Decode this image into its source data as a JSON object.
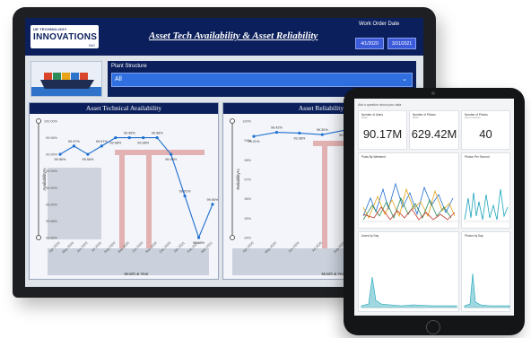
{
  "dashboard": {
    "brand_top": "UE TECHNOLOGY",
    "brand_main": "INNOVATIONS",
    "brand_inc": "INC",
    "title": "Asset Tech Availability & Asset Reliability",
    "work_order_label": "Work Order Date",
    "date_start": "4/1/2020",
    "date_end": "3/31/2021",
    "filter_label": "Plant Structure",
    "filter_value": "All",
    "colors": {
      "navy": "#0b1f5c",
      "accent": "#2f6fe0",
      "line": "#1f6fd1"
    }
  },
  "chart_data": [
    {
      "type": "line",
      "title": "Asset Technical Availability",
      "xlabel": "Month & Year",
      "ylabel": "Availability%",
      "categories": [
        "Apr 2020",
        "May 2020",
        "Jun 2020",
        "Jul 2020",
        "Aug 2020",
        "Sep 2020",
        "Oct 2020",
        "Nov 2020",
        "Dec 2020",
        "Jan 2021",
        "Feb 2021",
        "Mar 2021"
      ],
      "values": [
        99.96,
        99.97,
        99.96,
        99.97,
        99.98,
        99.98,
        99.98,
        99.98,
        99.96,
        99.91,
        99.86,
        99.9
      ],
      "data_labels": [
        "99.96%",
        "99.97%",
        "99.96%",
        "99.97%",
        "99.98%",
        "99.98%",
        "99.98%",
        "99.98%",
        "99.96%",
        "99.91%",
        "99.86%",
        "99.90%"
      ],
      "yticks": [
        "100.00%",
        "99.98%",
        "99.96%",
        "99.94%",
        "99.92%",
        "99.90%",
        "99.88%",
        "99.86%"
      ],
      "ylim": [
        99.86,
        100.0
      ],
      "grid": false
    },
    {
      "type": "line",
      "title": "Asset Reliability",
      "xlabel": "Month & Year",
      "ylabel": "Reliability%",
      "categories": [
        "Apr 2020",
        "May 2020",
        "Jun 2020",
        "Jul 2020",
        "Aug 2020",
        "Sep 2020",
        "Oct 2020",
        "Nov 2020"
      ],
      "values": [
        99.21,
        99.42,
        99.38,
        99.3,
        99.53,
        99.6,
        99.55,
        99.5
      ],
      "data_labels": [
        "99.21%",
        "99.42%",
        "99.38%",
        "99.30%",
        "99.53%"
      ],
      "label_indices": [
        0,
        1,
        2,
        3,
        4
      ],
      "yticks": [
        "100%",
        "99%",
        "98%",
        "97%",
        "96%",
        "95%",
        "94%"
      ],
      "ylim": [
        94,
        100
      ],
      "grid": false
    }
  ],
  "tablet": {
    "qna": "Ask a question about your data",
    "cards": [
      {
        "title": "Number of Users",
        "sub": "Rows",
        "value": "90.17M"
      },
      {
        "title": "Number of Photos",
        "sub": "Rows",
        "value": "629.42M"
      },
      {
        "title": "Number of Photos",
        "sub": "Live to Account",
        "value": "40"
      }
    ],
    "panels": [
      "Posts By Weekend",
      "Photos Per Second",
      "Users by Day",
      "Photos by Day"
    ]
  }
}
